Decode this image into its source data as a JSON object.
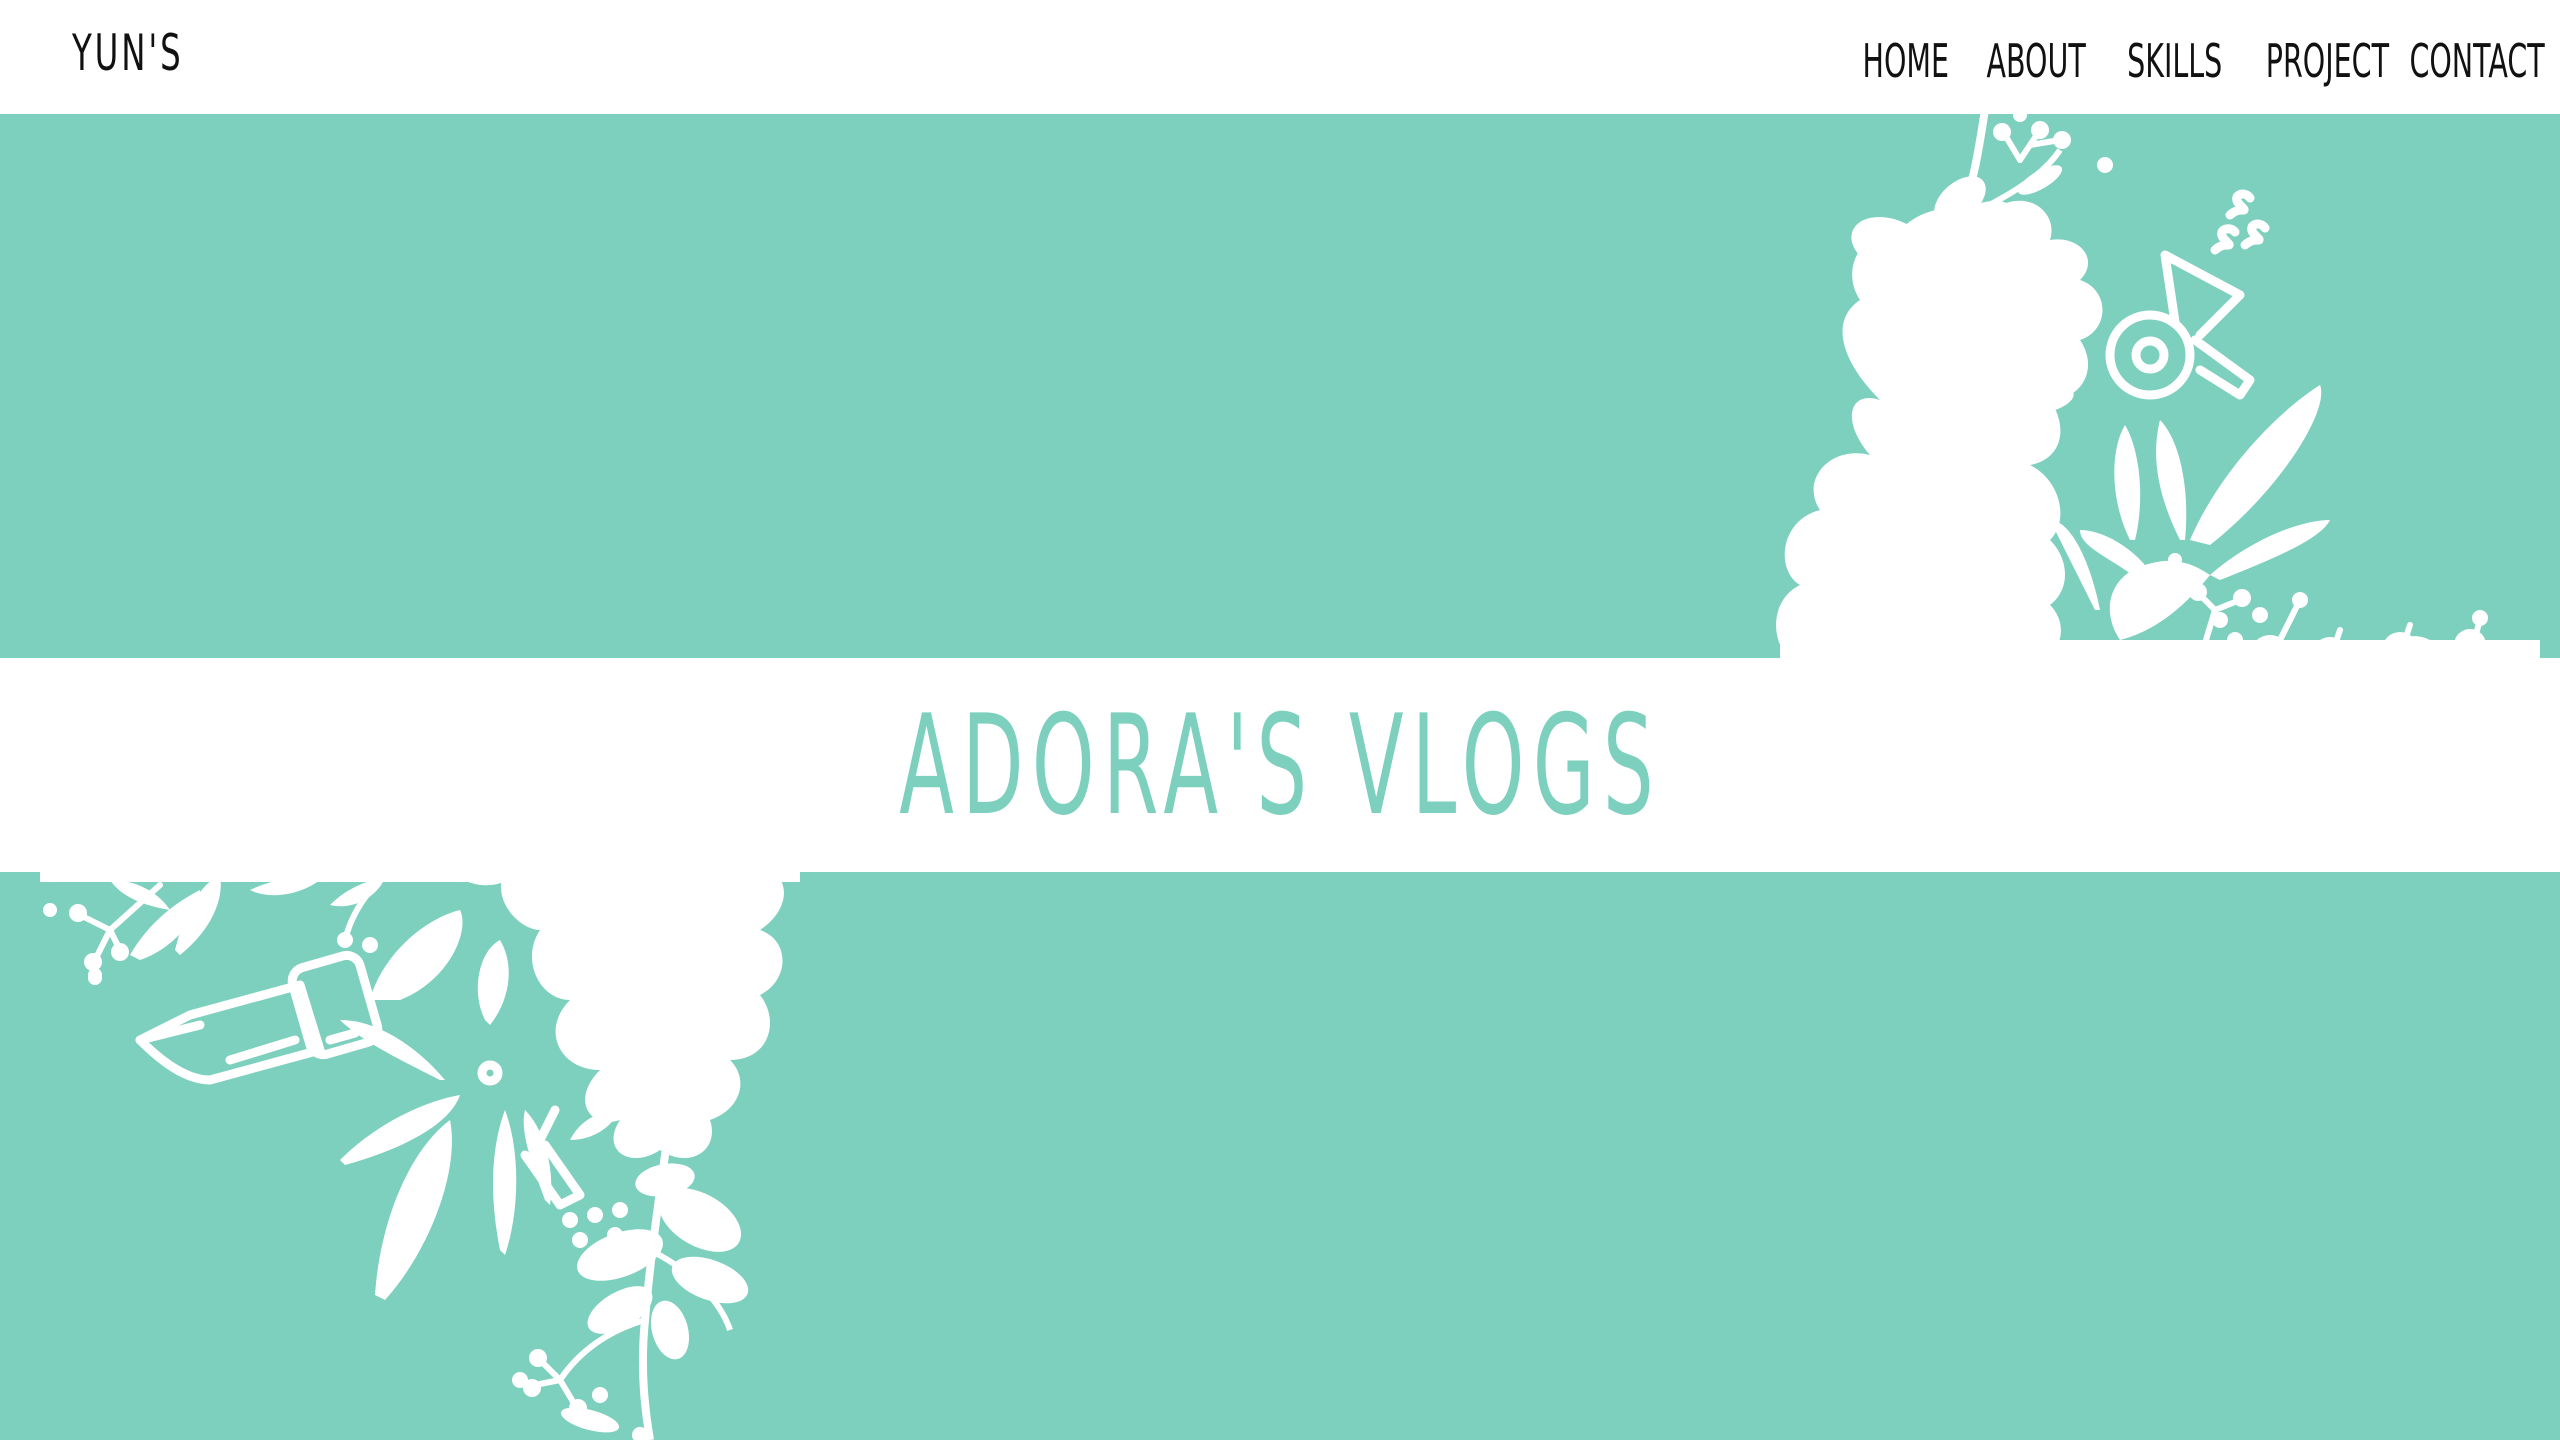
{
  "header": {
    "brand": "YUN'S",
    "nav": [
      {
        "label": "HOME"
      },
      {
        "label": "ABOUT"
      },
      {
        "label": "SKILLS"
      },
      {
        "label": "PROJECT"
      },
      {
        "label": "CONTACT"
      }
    ]
  },
  "hero": {
    "title": "ADORA'S VLOGS"
  },
  "theme": {
    "accent": "#7dd0be",
    "band": "#ffffff",
    "text": "#111111"
  },
  "decorations": {
    "top_right": [
      "flower-cluster",
      "hair-dryer-icon",
      "leaf-sprig"
    ],
    "bottom_left": [
      "flower-cluster",
      "curling-iron-icon",
      "leaf-sprig"
    ]
  }
}
